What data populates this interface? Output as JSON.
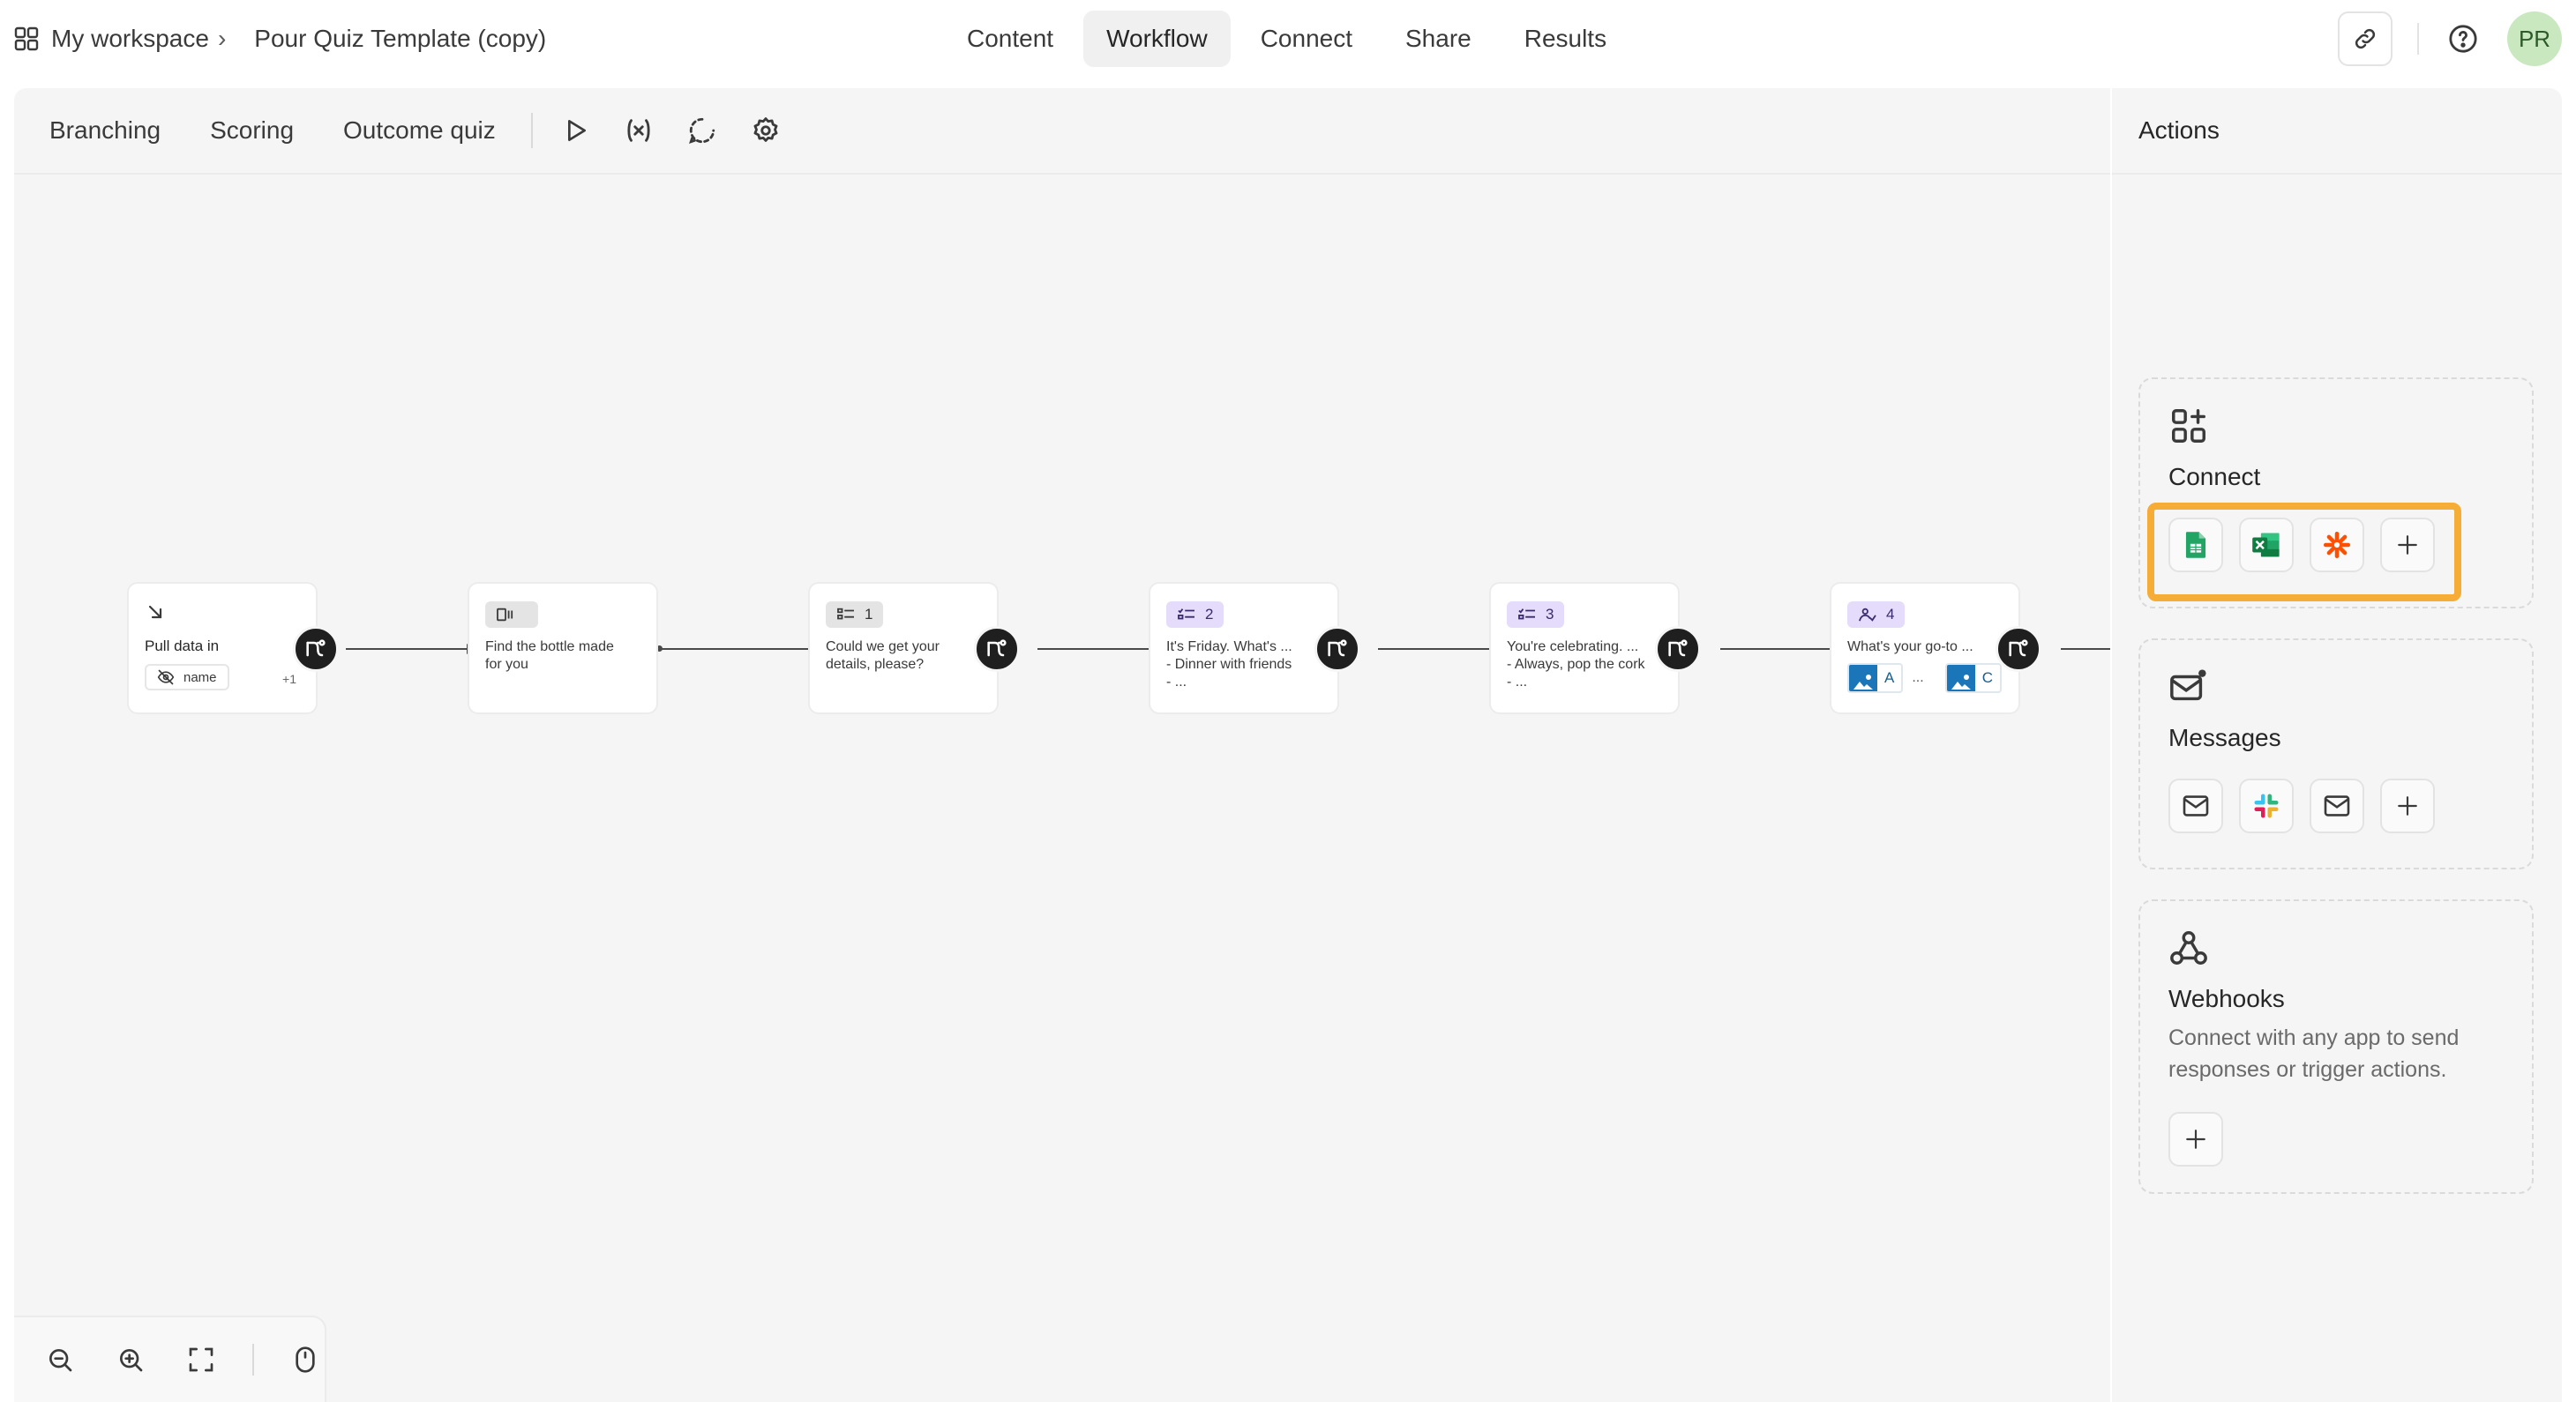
{
  "breadcrumb": {
    "workspace": "My workspace",
    "separator": "›",
    "form_title": "Pour Quiz Template (copy)"
  },
  "nav_tabs": [
    {
      "label": "Content",
      "active": false
    },
    {
      "label": "Workflow",
      "active": true
    },
    {
      "label": "Connect",
      "active": false
    },
    {
      "label": "Share",
      "active": false
    },
    {
      "label": "Results",
      "active": false
    }
  ],
  "user": {
    "initials": "PR",
    "avatar_color": "#c9e8c0"
  },
  "canvas_toolbar": {
    "branching": "Branching",
    "scoring": "Scoring",
    "outcome_quiz": "Outcome quiz",
    "icons": [
      "play-icon",
      "variables-icon",
      "loop-icon",
      "settings-icon"
    ]
  },
  "nodes": [
    {
      "type": "pull-data",
      "title": "Pull data in",
      "pill": "name",
      "extra": "+1"
    },
    {
      "type": "welcome",
      "text": "Find the bottle made\nfor you"
    },
    {
      "type": "question",
      "number": "1",
      "text": "Could we get your\ndetails, please?"
    },
    {
      "type": "multiple-choice",
      "number": "2",
      "text": "It's Friday. What's ...\n- Dinner with friends\n- ..."
    },
    {
      "type": "multiple-choice",
      "number": "3",
      "text": "You're celebrating. ...\n- Always, pop the cork\n- ..."
    },
    {
      "type": "picture-choice",
      "number": "4",
      "text": "What's your go-to ...",
      "chips": [
        "A",
        "C"
      ],
      "ellipsis": "..."
    }
  ],
  "actions_panel": {
    "title": "Actions",
    "connect": {
      "title": "Connect",
      "integrations": [
        "google-sheets-icon",
        "excel-icon",
        "zapier-icon",
        "add-icon"
      ]
    },
    "messages": {
      "title": "Messages",
      "integrations": [
        "email-icon",
        "slack-icon",
        "email-icon",
        "add-icon"
      ]
    },
    "webhooks": {
      "title": "Webhooks",
      "description": "Connect with any app to send responses or trigger actions."
    }
  },
  "colors": {
    "highlight": "#f6ad37",
    "node_badge_purple": "#e4dcfa",
    "canvas_bg": "#f5f5f5"
  }
}
